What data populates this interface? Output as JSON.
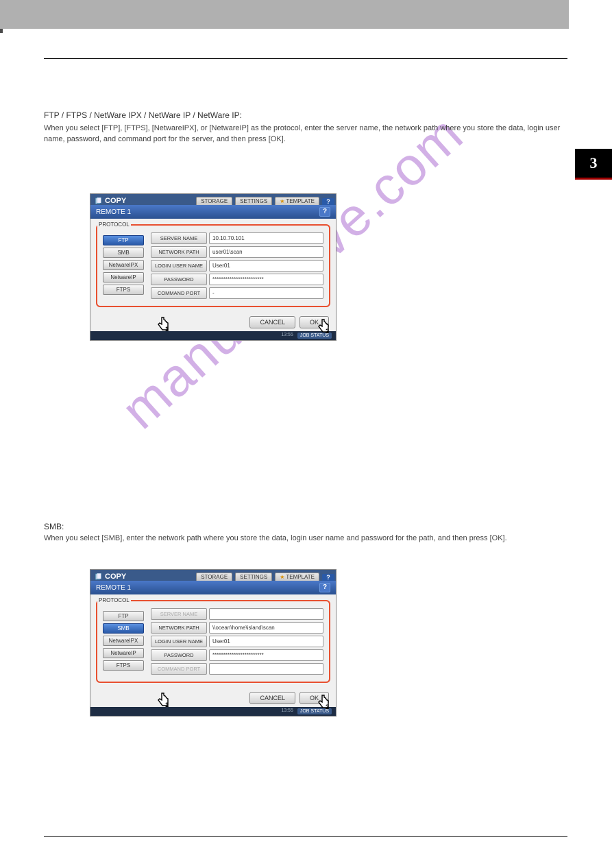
{
  "page": {
    "side_tab": "3",
    "heading_ftp": "FTP / FTPS / NetWare IPX / NetWare IP / NetWare IP:",
    "intro_ftp": "When you select [FTP], [FTPS], [NetwareIPX], or [NetwareIP] as the protocol, enter the server name, the network path where you store the data, login user name, password, and command port for the server, and then press [OK].",
    "heading_smb": "SMB:",
    "intro_smb": "When you select [SMB], enter the network path where you store the data, login user name and password for the path, and then press [OK]."
  },
  "panelA": {
    "copy": "COPY",
    "tabs": {
      "storage": "STORAGE",
      "settings": "SETTINGS",
      "template": "TEMPLATE",
      "help": "?"
    },
    "title": "REMOTE 1",
    "protocol_label": "PROTOCOL",
    "protocols": {
      "ftp": "FTP",
      "smb": "SMB",
      "nwipx": "NetwareIPX",
      "nwip": "NetwareIP",
      "ftps": "FTPS"
    },
    "fields": {
      "server_name_label": "SERVER NAME",
      "server_name": "10.10.70.101",
      "network_path_label": "NETWORK PATH",
      "network_path": "user01\\scan",
      "login_label": "LOGIN USER NAME",
      "login": "User01",
      "password_label": "PASSWORD",
      "password": "************************",
      "command_port_label": "COMMAND PORT",
      "command_port": "-"
    },
    "buttons": {
      "cancel": "CANCEL",
      "ok": "OK"
    },
    "status_time": "13:55",
    "status_job": "JOB STATUS"
  },
  "panelB": {
    "copy": "COPY",
    "tabs": {
      "storage": "STORAGE",
      "settings": "SETTINGS",
      "template": "TEMPLATE",
      "help": "?"
    },
    "title": "REMOTE 1",
    "protocol_label": "PROTOCOL",
    "protocols": {
      "ftp": "FTP",
      "smb": "SMB",
      "nwipx": "NetwareIPX",
      "nwip": "NetwareIP",
      "ftps": "FTPS"
    },
    "fields": {
      "server_name_label": "SERVER NAME",
      "server_name": "",
      "network_path_label": "NETWORK PATH",
      "network_path": "\\\\ocean\\home\\island\\scan",
      "login_label": "LOGIN USER NAME",
      "login": "User01",
      "password_label": "PASSWORD",
      "password": "************************",
      "command_port_label": "COMMAND PORT",
      "command_port": ""
    },
    "buttons": {
      "cancel": "CANCEL",
      "ok": "OK"
    },
    "status_time": "13:55",
    "status_job": "JOB STATUS"
  },
  "watermark": "manualshive.com"
}
